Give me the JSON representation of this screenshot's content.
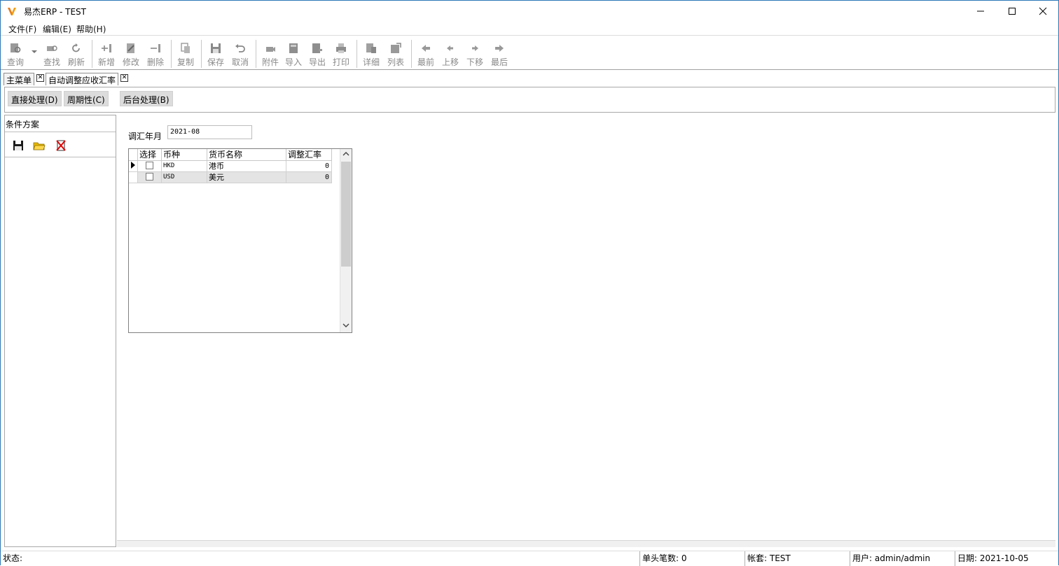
{
  "window": {
    "title": "易杰ERP - TEST"
  },
  "menu": [
    "文件(F)",
    "编辑(E)",
    "帮助(H)"
  ],
  "toolbar": {
    "buttons": [
      {
        "label": "查询",
        "icon": "query-icon"
      },
      {
        "label": "查找",
        "icon": "find-icon"
      },
      {
        "label": "刷新",
        "icon": "refresh-icon"
      },
      {
        "label": "新增",
        "icon": "add-icon"
      },
      {
        "label": "修改",
        "icon": "edit-icon"
      },
      {
        "label": "删除",
        "icon": "delete-icon"
      },
      {
        "label": "复制",
        "icon": "copy-icon"
      },
      {
        "label": "保存",
        "icon": "save-icon"
      },
      {
        "label": "取消",
        "icon": "undo-icon"
      },
      {
        "label": "附件",
        "icon": "attach-icon"
      },
      {
        "label": "导入",
        "icon": "import-icon"
      },
      {
        "label": "导出",
        "icon": "export-icon"
      },
      {
        "label": "打印",
        "icon": "print-icon"
      },
      {
        "label": "详细",
        "icon": "detail-icon"
      },
      {
        "label": "列表",
        "icon": "list-icon"
      },
      {
        "label": "最前",
        "icon": "first-icon"
      },
      {
        "label": "上移",
        "icon": "prev-icon"
      },
      {
        "label": "下移",
        "icon": "next-icon"
      },
      {
        "label": "最后",
        "icon": "last-icon"
      }
    ]
  },
  "tabs": [
    {
      "label": "主菜单"
    },
    {
      "label": "自动调整应收汇率"
    }
  ],
  "actions": [
    "直接处理(D)",
    "周期性(C)",
    "后台处理(B)"
  ],
  "left_panel": {
    "title": "条件方案",
    "icons": [
      "save-icon",
      "open-folder-icon",
      "delete-scheme-icon"
    ]
  },
  "form": {
    "label": "调汇年月",
    "value": "2021-08"
  },
  "grid": {
    "columns": [
      "选择",
      "币种",
      "货币名称",
      "调整汇率"
    ],
    "rows": [
      {
        "selected": false,
        "code": "HKD",
        "name": "港币",
        "rate": "0",
        "current": true
      },
      {
        "selected": false,
        "code": "USD",
        "name": "美元",
        "rate": "0",
        "current": false
      }
    ]
  },
  "status": {
    "state": "状态:",
    "count": "单头笔数: 0",
    "account": "帐套: TEST",
    "user": "用户: admin/admin",
    "date": "日期: 2021-10-05"
  },
  "colors": {
    "window_border": "#2b77b8",
    "button_bg": "#dcdcdc",
    "disabled_text": "#8a8a8a"
  }
}
